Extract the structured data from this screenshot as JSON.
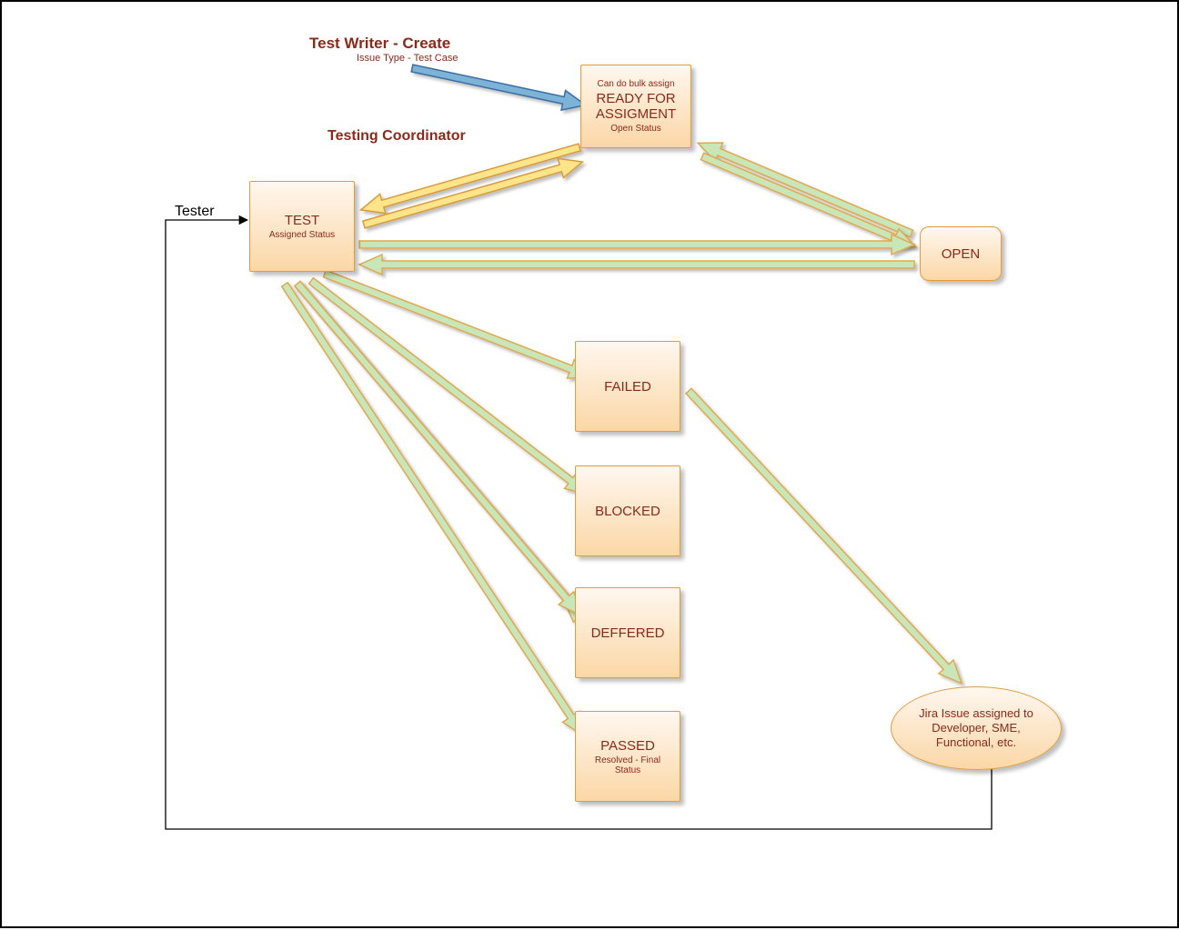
{
  "labels": {
    "testwriter_title": "Test Writer - Create",
    "testwriter_sub": "Issue Type - Test Case",
    "testing_coordinator": "Testing Coordinator",
    "tester": "Tester"
  },
  "nodes": {
    "ready": {
      "pre": "Can do bulk assign",
      "title1": "READY FOR",
      "title2": "ASSIGMENT",
      "sub": "Open Status"
    },
    "test": {
      "title": "TEST",
      "sub": "Assigned Status"
    },
    "open": {
      "title": "OPEN"
    },
    "failed": {
      "title": "FAILED"
    },
    "blocked": {
      "title": "BLOCKED"
    },
    "deffered": {
      "title": "DEFFERED"
    },
    "passed": {
      "title": "PASSED",
      "sub1": "Resolved - Final",
      "sub2": "Status"
    },
    "jira": {
      "line1": "Jira Issue assigned to",
      "line2": "Developer, SME,",
      "line3": "Functional, etc."
    }
  },
  "colors": {
    "node_border": "#e59b3a",
    "node_fill_top": "#fff7ef",
    "node_fill_bottom": "#fbd7a6",
    "text": "#8a2a1a",
    "arrow_green_fill": "#c9e6b8",
    "arrow_green_stroke": "#e0a84f",
    "arrow_yellow_fill": "#ffe48a",
    "arrow_yellow_stroke": "#d89a3a",
    "arrow_blue_fill": "#7bb3d6",
    "arrow_blue_stroke": "#3a6ea5"
  }
}
